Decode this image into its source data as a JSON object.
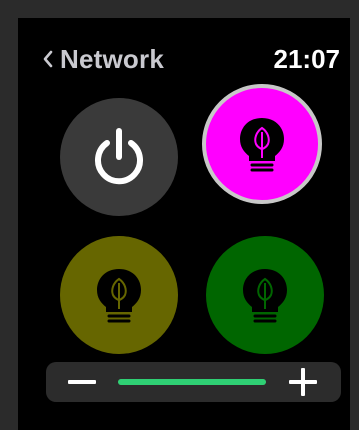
{
  "status_bar": {
    "back_label": "Network",
    "back_icon": "chevron-left-icon",
    "time": "21:07"
  },
  "tiles": [
    {
      "name": "power",
      "icon": "power-icon",
      "background": "#3a3a3a",
      "icon_color": "#ffffff"
    },
    {
      "name": "bulb-magenta",
      "icon": "lightbulb-leaf-icon",
      "background": "#ff00ff",
      "icon_color": "#000000",
      "selected": true
    },
    {
      "name": "bulb-olive",
      "icon": "lightbulb-leaf-icon",
      "background": "#666600",
      "icon_color": "#000000"
    },
    {
      "name": "bulb-green",
      "icon": "lightbulb-leaf-icon",
      "background": "#006600",
      "icon_color": "#000000"
    }
  ],
  "brightness_slider": {
    "decrease_icon": "minus-icon",
    "increase_icon": "plus-icon",
    "level": 1.0,
    "fill_color": "#2fd074"
  },
  "colors": {
    "background": "#000000",
    "frame": "#2b2b2b",
    "accent": "#2fd074"
  }
}
